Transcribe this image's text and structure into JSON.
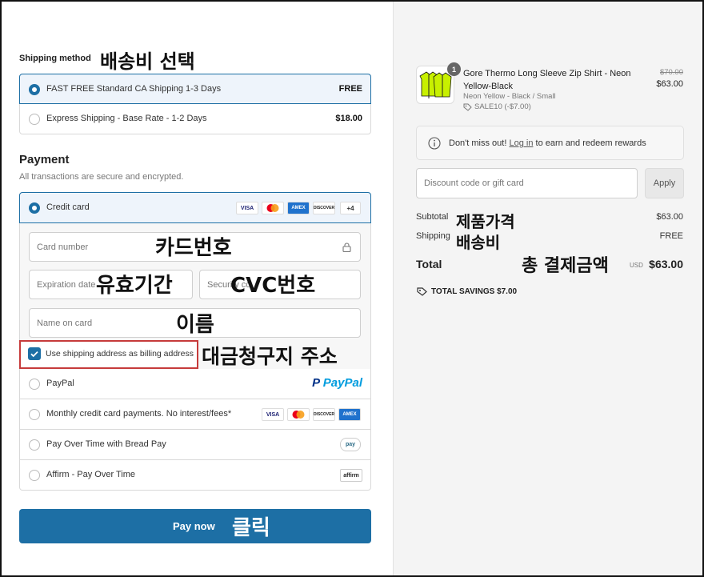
{
  "annotations": {
    "shipping_method": "배송비 선택",
    "card_number": "카드번호",
    "expiration": "유효기간",
    "cvc": "CVC번호",
    "name": "이름",
    "billing": "대금청구지 주소",
    "pay_click": "클릭",
    "subtotal": "제품가격",
    "shipping": "배송비",
    "total": "총 결제금액"
  },
  "shipping": {
    "title": "Shipping method",
    "options": [
      {
        "label": "FAST FREE Standard CA Shipping 1-3 Days",
        "price": "FREE",
        "selected": true
      },
      {
        "label": "Express Shipping - Base Rate - 1-2 Days",
        "price": "$18.00",
        "selected": false
      }
    ]
  },
  "payment": {
    "title": "Payment",
    "subtitle": "All transactions are secure and encrypted.",
    "credit_card_label": "Credit card",
    "card_more": "+4",
    "card_number_placeholder": "Card number",
    "expiration_placeholder": "Expiration date",
    "security_placeholder": "Security code",
    "name_placeholder": "Name on card",
    "billing_checkbox": "Use shipping address as billing address",
    "options": [
      {
        "label": "PayPal"
      },
      {
        "label": "Monthly credit card payments. No interest/fees*"
      },
      {
        "label": "Pay Over Time with Bread Pay"
      },
      {
        "label": "Affirm - Pay Over Time"
      }
    ],
    "pay_button": "Pay now"
  },
  "brands": {
    "visa": "VISA",
    "amex": "AMEX",
    "discover": "DISCOVER",
    "paypal_p": "P",
    "paypal_word": "PayPal",
    "bread": "pay",
    "affirm": "affirm"
  },
  "order": {
    "quantity": "1",
    "product_name": "Gore Thermo Long Sleeve Zip Shirt - Neon Yellow-Black",
    "variant": "Neon Yellow - Black / Small",
    "discount_tag": "SALE10 (-$7.00)",
    "original_price": "$70.00",
    "price": "$63.00",
    "rewards_prefix": "Don't miss out!",
    "rewards_link": "Log in",
    "rewards_suffix": "to earn and redeem rewards",
    "discount_placeholder": "Discount code or gift card",
    "apply_button": "Apply",
    "subtotal_label": "Subtotal",
    "subtotal_value": "$63.00",
    "shipping_label": "Shipping",
    "shipping_value": "FREE",
    "total_label": "Total",
    "currency": "USD",
    "total_value": "$63.00",
    "savings_label": "TOTAL SAVINGS",
    "savings_value": "$7.00"
  }
}
